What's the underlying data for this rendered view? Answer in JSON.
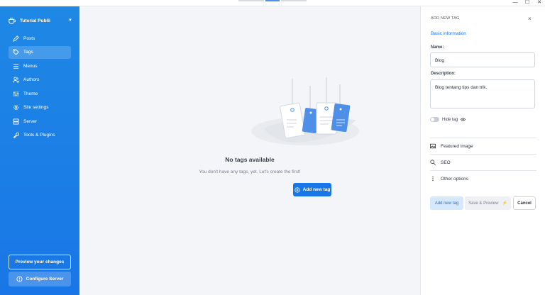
{
  "window": {
    "minimize": "—",
    "maximize": "☐",
    "close": "✕"
  },
  "sidebar": {
    "site_name": "Tutorial Publii",
    "items": [
      {
        "label": "Posts",
        "icon": "pen-icon"
      },
      {
        "label": "Tags",
        "icon": "tag-icon",
        "active": true
      },
      {
        "label": "Menus",
        "icon": "menu-icon"
      },
      {
        "label": "Authors",
        "icon": "users-icon"
      },
      {
        "label": "Theme",
        "icon": "sliders-icon"
      },
      {
        "label": "Site settings",
        "icon": "gear-icon"
      },
      {
        "label": "Server",
        "icon": "server-icon"
      },
      {
        "label": "Tools & Plugins",
        "icon": "wrench-icon"
      }
    ],
    "preview_label": "Preview your changes",
    "configure_label": "Configure Server"
  },
  "main": {
    "empty_title": "No tags available",
    "empty_subtitle": "You don't have any tags, yet. Let's create the first!",
    "add_button": "Add new tag"
  },
  "panel": {
    "heading": "ADD NEW TAG",
    "close": "×",
    "tab": "Basic information",
    "name_label": "Name:",
    "name_value": "Blog",
    "description_label": "Description:",
    "description_value": "Blog tentang tips dan trik.",
    "hide_tag_label": "Hide tag",
    "hide_tag_on": false,
    "sections": [
      "Featured image",
      "SEO",
      "Other options"
    ],
    "add_button": "Add new tag",
    "save_preview_button": "Save & Preview",
    "cancel_button": "Cancel"
  },
  "colors": {
    "accent": "#1976e6",
    "sidebar": "#1e88e5",
    "main_bg": "#f4f5f8"
  }
}
